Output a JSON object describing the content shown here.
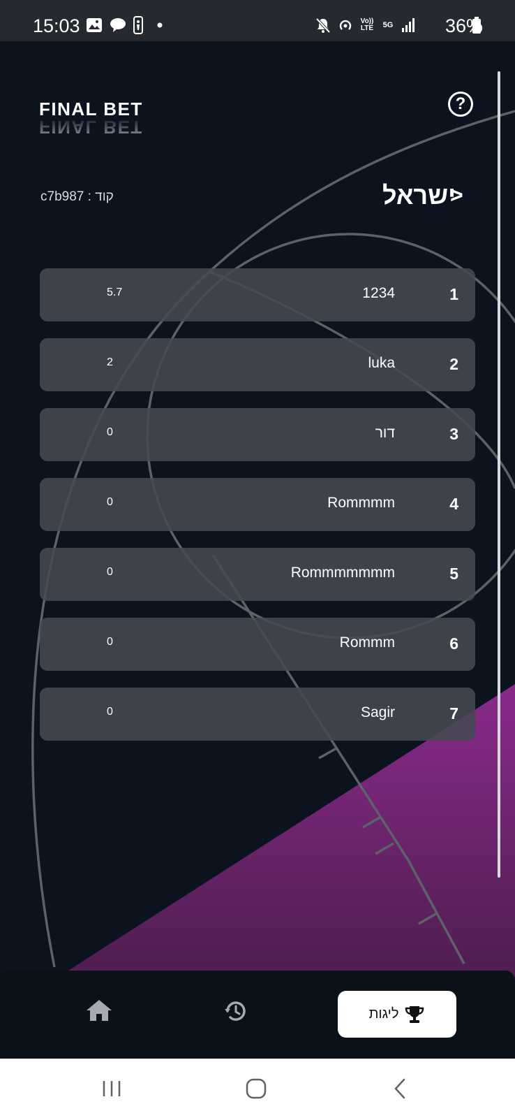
{
  "status_bar": {
    "time": "15:03",
    "battery": "36%",
    "network": "5G",
    "volte": "Vo)) LTE"
  },
  "header": {
    "logo_text": "FINAL BET",
    "help_symbol": "?"
  },
  "league": {
    "title": "ישראל",
    "back_symbol": ">",
    "code_label": "קוד : c7b987"
  },
  "standings": [
    {
      "rank": "1",
      "name": "1234",
      "score": "5.7"
    },
    {
      "rank": "2",
      "name": "luka",
      "score": "2"
    },
    {
      "rank": "3",
      "name": "דור",
      "score": "0"
    },
    {
      "rank": "4",
      "name": "Rommmm",
      "score": "0"
    },
    {
      "rank": "5",
      "name": "Rommmmmmm",
      "score": "0"
    },
    {
      "rank": "6",
      "name": "Rommm",
      "score": "0"
    },
    {
      "rank": "7",
      "name": "Sagir",
      "score": "0"
    }
  ],
  "bottom_nav": {
    "home_icon": "home-icon",
    "history_icon": "history-icon",
    "leagues_label": "ליגות",
    "leagues_icon": "trophy-icon"
  },
  "colors": {
    "background": "#0b131e",
    "row": "#444952",
    "accent_purple": "#7a2a7c"
  }
}
